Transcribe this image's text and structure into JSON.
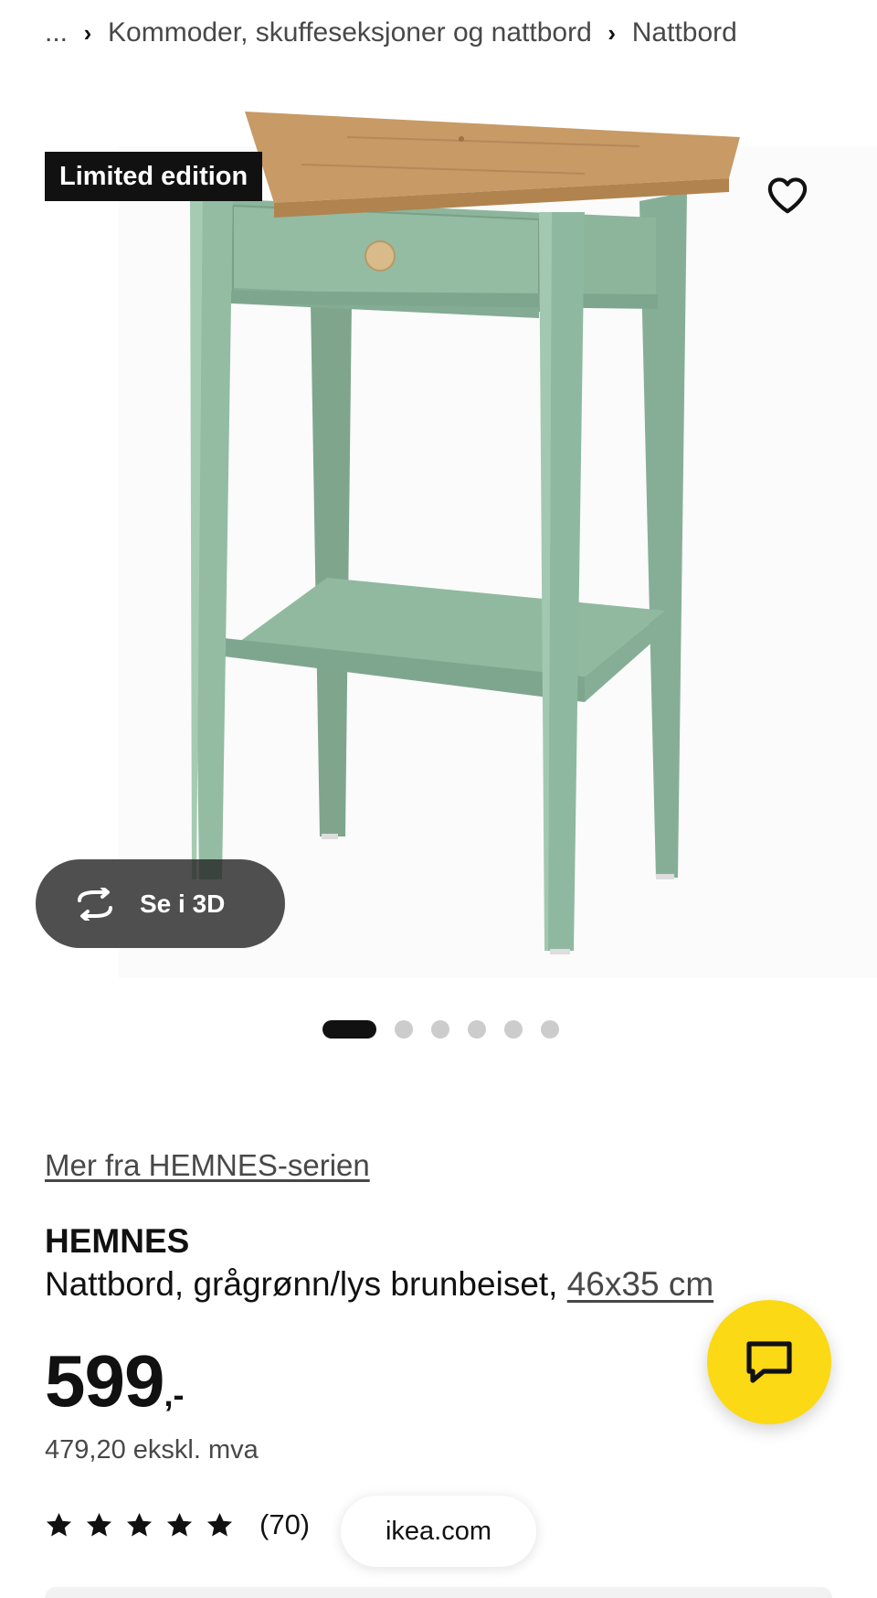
{
  "breadcrumb": {
    "ellipsis": "...",
    "separator": "›",
    "items": [
      "Kommoder, skuffeseksjoner og nattbord",
      "Nattbord"
    ]
  },
  "image": {
    "badge": "Limited edition",
    "view3d_label": "Se i 3D",
    "favorite_icon": "heart-icon",
    "rotate_icon": "rotate-3d-icon",
    "carousel": {
      "total": 6,
      "active": 1
    }
  },
  "product": {
    "series_link": "Mer fra HEMNES-serien",
    "name": "HEMNES",
    "description": "Nattbord, grågrønn/lys brunbeiset, ",
    "dimensions": "46x35 cm",
    "price_amount": "599",
    "price_suffix": ",-",
    "price_ex_vat": "479,20 ekskl. mva",
    "rating_stars": 5,
    "rating_count": "(70)"
  },
  "browser": {
    "url": "ikea.com"
  },
  "colors": {
    "accent_yellow": "#FBD914",
    "text_primary": "#111111",
    "text_secondary": "#484848",
    "table_green": "#8fb8a0",
    "table_top_wood": "#c79a66"
  }
}
